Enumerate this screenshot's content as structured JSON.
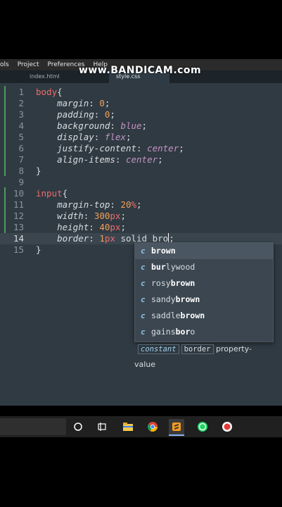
{
  "menubar": {
    "items": [
      "ols",
      "Project",
      "Preferences",
      "Help"
    ]
  },
  "watermark": "www.BANDICAM.com",
  "tabs": [
    "index.html",
    "style.css"
  ],
  "editor": {
    "lines": [
      {
        "n": "1"
      },
      {
        "n": "2"
      },
      {
        "n": "3"
      },
      {
        "n": "4"
      },
      {
        "n": "5"
      },
      {
        "n": "6"
      },
      {
        "n": "7"
      },
      {
        "n": "8"
      },
      {
        "n": "9"
      },
      {
        "n": "10"
      },
      {
        "n": "11"
      },
      {
        "n": "12"
      },
      {
        "n": "13"
      },
      {
        "n": "14"
      },
      {
        "n": "15"
      }
    ],
    "code": {
      "l1_sel": "body",
      "l1_p": "{",
      "l2_prop": "margin",
      "l2_val": "0",
      "l3_prop": "padding",
      "l3_val": "0",
      "l4_prop": "background",
      "l4_val": "blue",
      "l5_prop": "display",
      "l5_val": "flex",
      "l6_prop": "justify-content",
      "l6_val": "center",
      "l7_prop": "align-items",
      "l7_val": "center",
      "l8": "}",
      "l10_sel": "input",
      "l10_p": "{",
      "l11_prop": "margin-top",
      "l11_num": "20",
      "l11_unit": "%",
      "l12_prop": "width",
      "l12_num": "300",
      "l12_unit": "px",
      "l13_prop": "height",
      "l13_num": "40",
      "l13_unit": "px",
      "l14_prop": "border",
      "l14_num": "1",
      "l14_unit": "px",
      "l14_kw": "solid",
      "l14_typed": "bro",
      "l15": "}"
    }
  },
  "autocomplete": {
    "kind": "c",
    "items": [
      {
        "pre": "",
        "bold": "brown",
        "post": ""
      },
      {
        "pre": "",
        "bold": "bur",
        "post": "lywood"
      },
      {
        "pre": "rosy",
        "bold": "brown",
        "post": ""
      },
      {
        "pre": "sandy",
        "bold": "brown",
        "post": ""
      },
      {
        "pre": "saddle",
        "bold": "brown",
        "post": ""
      },
      {
        "pre": "gains",
        "bold": "bor",
        "post": "o"
      }
    ],
    "detail": {
      "kind": "constant",
      "badge": "border",
      "text": "property-value"
    }
  },
  "colors": {
    "editor_bg": "#303a42",
    "selector": "#ec6c6c",
    "number": "#f29f5c",
    "keyword": "#c594c5"
  },
  "taskbar": {
    "icons": [
      "task-view-icon",
      "timeline-icon",
      "file-explorer-icon",
      "chrome-icon",
      "sublime-icon",
      "whatsapp-icon",
      "record-icon"
    ]
  }
}
